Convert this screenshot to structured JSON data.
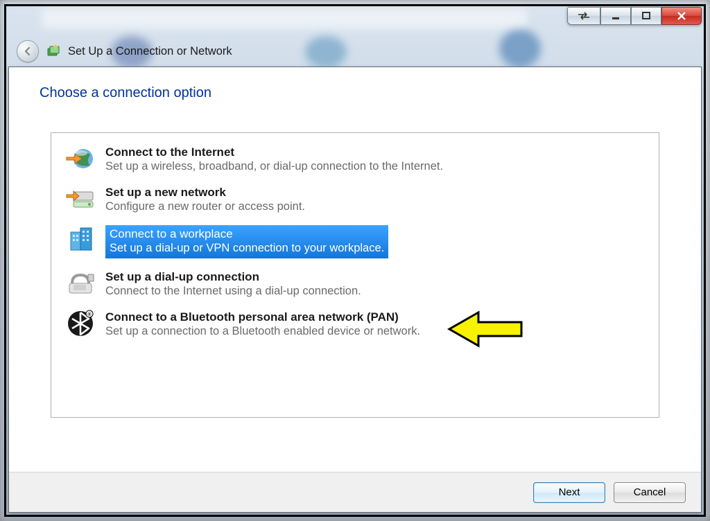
{
  "window": {
    "title": "Set Up a Connection or Network"
  },
  "page": {
    "heading": "Choose a connection option"
  },
  "options": [
    {
      "title": "Connect to the Internet",
      "desc": "Set up a wireless, broadband, or dial-up connection to the Internet.",
      "icon": "globe-arrow-icon",
      "selected": false
    },
    {
      "title": "Set up a new network",
      "desc": "Configure a new router or access point.",
      "icon": "router-icon",
      "selected": false
    },
    {
      "title": "Connect to a workplace",
      "desc": "Set up a dial-up or VPN connection to your workplace.",
      "icon": "buildings-icon",
      "selected": true
    },
    {
      "title": "Set up a dial-up connection",
      "desc": "Connect to the Internet using a dial-up connection.",
      "icon": "phone-modem-icon",
      "selected": false
    },
    {
      "title": "Connect to a Bluetooth personal area network (PAN)",
      "desc": "Set up a connection to a Bluetooth enabled device or network.",
      "icon": "bluetooth-icon",
      "selected": false
    }
  ],
  "footer": {
    "next": "Next",
    "cancel": "Cancel"
  }
}
